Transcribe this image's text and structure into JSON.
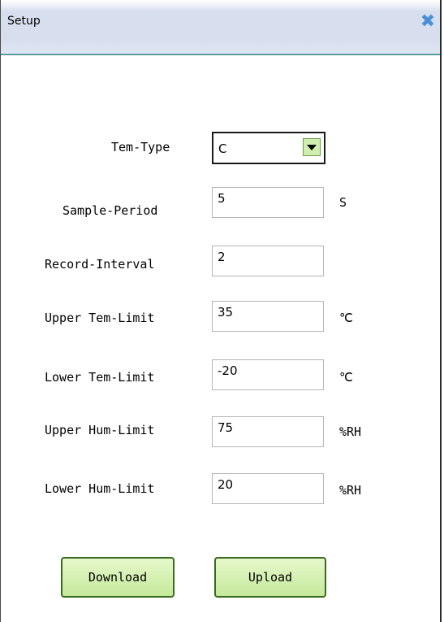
{
  "window": {
    "title": "Setup",
    "close_icon": "close-icon"
  },
  "form": {
    "tem_type": {
      "label": "Tem-Type",
      "value": "C"
    },
    "sample_period": {
      "label": "Sample-Period",
      "value": "5",
      "unit": "S"
    },
    "record_interval": {
      "label": "Record-Interval",
      "value": "2"
    },
    "upper_tem_limit": {
      "label": "Upper Tem-Limit",
      "value": "35",
      "unit": "℃"
    },
    "lower_tem_limit": {
      "label": "Lower Tem-Limit",
      "value": "-20",
      "unit": "℃"
    },
    "upper_hum_limit": {
      "label": "Upper Hum-Limit",
      "value": "75",
      "unit": "%RH"
    },
    "lower_hum_limit": {
      "label": "Lower Hum-Limit",
      "value": "20",
      "unit": "%RH"
    }
  },
  "buttons": {
    "download": "Download",
    "upload": "Upload"
  },
  "colors": {
    "title_bar": "#d7dfee",
    "button_fill": "#c4e99a",
    "close_icon": "#4a8fd6"
  }
}
